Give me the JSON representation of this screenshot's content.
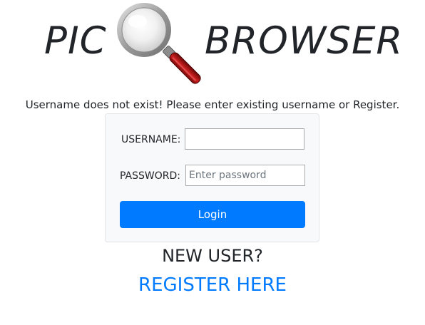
{
  "header": {
    "logo_left": "PIC",
    "logo_right": "BROWSER",
    "logo_icon": "magnifying-glass-icon"
  },
  "message": {
    "error": "Username does not exist! Please enter existing username or Register."
  },
  "login_form": {
    "username_label": "USERNAME:",
    "username_value": "",
    "password_label": "PASSWORD:",
    "password_placeholder": "Enter password",
    "login_button": "Login"
  },
  "register": {
    "prompt": "NEW USER?",
    "link": "REGISTER HERE"
  },
  "colors": {
    "primary": "#007bff",
    "card_background": "#f8f9fa",
    "text": "#212529"
  }
}
